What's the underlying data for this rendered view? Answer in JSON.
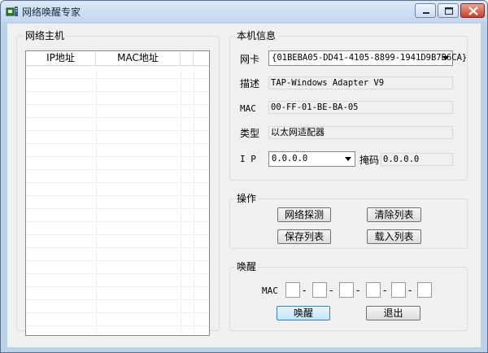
{
  "window": {
    "title": "网络唤醒专家",
    "controls": {
      "minimize_icon": "minimize-icon",
      "maximize_icon": "maximize-icon",
      "close_icon": "close-icon"
    }
  },
  "hosts": {
    "legend": "网络主机",
    "columns": [
      "IP地址",
      "MAC地址"
    ],
    "rows": []
  },
  "local_info": {
    "legend": "本机信息",
    "nic_label": "网卡",
    "nic_value": "{01BEBA05-DD41-4105-8899-1941D9B7B6CA}",
    "desc_label": "描述",
    "desc_value": "TAP-Windows Adapter V9",
    "mac_label": "MAC",
    "mac_value": "00-FF-01-BE-BA-05",
    "type_label": "类型",
    "type_value": "以太网适配器",
    "ip_label": "I P",
    "ip_value": "0.0.0.0",
    "mask_label": "掩码",
    "mask_value": "0.0.0.0"
  },
  "operations": {
    "legend": "操作",
    "scan_label": "网络探测",
    "clear_label": "清除列表",
    "save_label": "保存列表",
    "load_label": "载入列表"
  },
  "wake": {
    "legend": "唤醒",
    "mac_label": "MAC",
    "mac_fields": [
      "",
      "",
      "",
      "",
      "",
      ""
    ],
    "wake_label": "唤醒",
    "exit_label": "退出"
  }
}
